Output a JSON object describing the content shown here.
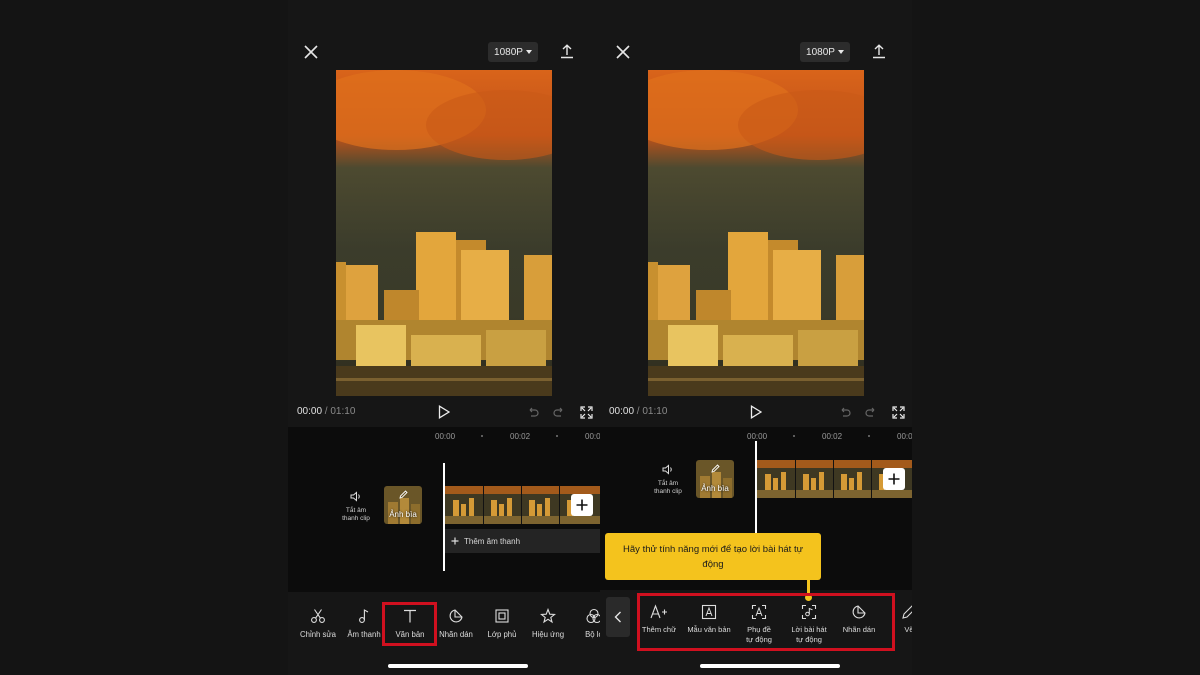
{
  "screens": [
    {
      "resolution": "1080P",
      "time_current": "00:00",
      "time_total": " / 01:10",
      "ruler": [
        "00:00",
        "00:02",
        "00:0"
      ],
      "mute_label_line1": "Tắt âm",
      "mute_label_line2": "thanh clip",
      "cover_label": "Ảnh bìa",
      "add_audio": "Thêm âm thanh",
      "toolbar": [
        {
          "icon": "scissors-icon",
          "label": "Chỉnh sửa"
        },
        {
          "icon": "music-note-icon",
          "label": "Âm thanh"
        },
        {
          "icon": "text-icon",
          "label": "Văn bản"
        },
        {
          "icon": "sticker-icon",
          "label": "Nhãn dán"
        },
        {
          "icon": "overlay-icon",
          "label": "Lớp phủ"
        },
        {
          "icon": "effects-icon",
          "label": "Hiệu ứng"
        },
        {
          "icon": "filter-icon",
          "label": "Bộ lọ"
        }
      ]
    },
    {
      "resolution": "1080P",
      "time_current": "00:00",
      "time_total": " / 01:10",
      "ruler": [
        "00:00",
        "00:02",
        "00:0"
      ],
      "mute_label_line1": "Tắt âm",
      "mute_label_line2": "thanh clip",
      "cover_label": "Ảnh bìa",
      "tooltip": "Hãy thử tính năng mới để tạo lời bài hát tự động",
      "text_toolbar": [
        {
          "icon": "add-text-icon",
          "line1": "Thêm chữ",
          "line2": ""
        },
        {
          "icon": "text-template-icon",
          "line1": "Mẫu văn bản",
          "line2": ""
        },
        {
          "icon": "auto-captions-icon",
          "line1": "Phụ đề",
          "line2": "tự động"
        },
        {
          "icon": "auto-lyrics-icon",
          "line1": "Lời bài hát",
          "line2": "tự động"
        },
        {
          "icon": "sticker-icon",
          "line1": "Nhãn dán",
          "line2": ""
        },
        {
          "icon": "draw-icon",
          "line1": "Vẽ",
          "line2": ""
        }
      ]
    }
  ],
  "colors": {
    "highlight": "#d0101f",
    "tooltip": "#f4c31d",
    "background": "#141414"
  }
}
